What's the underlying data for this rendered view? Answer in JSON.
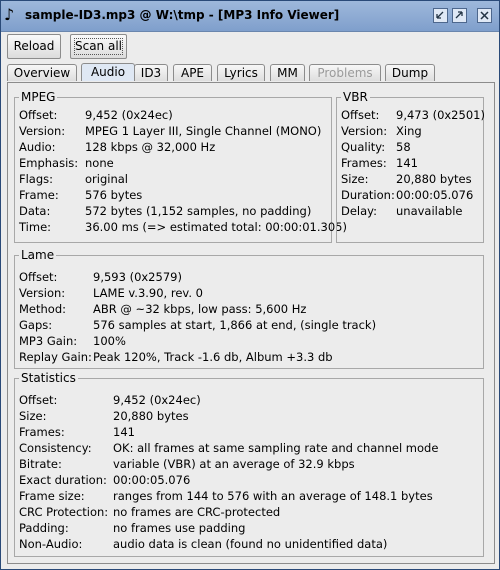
{
  "window": {
    "title": "sample-ID3.mp3 @ W:\\tmp - [MP3 Info Viewer]",
    "icon": "music-note-icon"
  },
  "toolbar": {
    "reload_label": "Reload",
    "scan_all_label": "Scan all"
  },
  "tabs": [
    {
      "label": "Overview"
    },
    {
      "label": "Audio"
    },
    {
      "label": "ID3"
    },
    {
      "label": "APE"
    },
    {
      "label": "Lyrics"
    },
    {
      "label": "MM"
    },
    {
      "label": "Problems"
    },
    {
      "label": "Dump"
    }
  ],
  "mpeg": {
    "title": "MPEG",
    "rows": [
      {
        "label": "Offset:",
        "value": "9,452 (0x24ec)"
      },
      {
        "label": "Version:",
        "value": "MPEG 1 Layer III, Single Channel (MONO)"
      },
      {
        "label": "Audio:",
        "value": "128 kbps @ 32,000 Hz"
      },
      {
        "label": "Emphasis:",
        "value": "none"
      },
      {
        "label": "Flags:",
        "value": "original"
      },
      {
        "label": "Frame:",
        "value": "576 bytes"
      },
      {
        "label": "Data:",
        "value": "572 bytes (1,152 samples, no padding)"
      },
      {
        "label": "Time:",
        "value": "36.00 ms (=> estimated total: 00:00:01.305)"
      }
    ]
  },
  "vbr": {
    "title": "VBR",
    "rows": [
      {
        "label": "Offset:",
        "value": "9,473 (0x2501)"
      },
      {
        "label": "Version:",
        "value": "Xing"
      },
      {
        "label": "Quality:",
        "value": "58"
      },
      {
        "label": "Frames:",
        "value": "141"
      },
      {
        "label": "Size:",
        "value": "20,880 bytes"
      },
      {
        "label": "Duration:",
        "value": "00:00:05.076"
      },
      {
        "label": "Delay:",
        "value": "unavailable"
      }
    ]
  },
  "lame": {
    "title": "Lame",
    "rows": [
      {
        "label": "Offset:",
        "value": "9,593 (0x2579)"
      },
      {
        "label": "Version:",
        "value": "LAME v.3.90, rev. 0"
      },
      {
        "label": "Method:",
        "value": "ABR @ ~32 kbps, low pass: 5,600 Hz"
      },
      {
        "label": "Gaps:",
        "value": "576 samples at start, 1,866 at end, (single track)"
      },
      {
        "label": "MP3 Gain:",
        "value": "100%"
      },
      {
        "label": "Replay Gain:",
        "value": "Peak 120%, Track -1.6 db, Album +3.3 db"
      }
    ]
  },
  "statistics": {
    "title": "Statistics",
    "rows": [
      {
        "label": "Offset:",
        "value": "9,452 (0x24ec)"
      },
      {
        "label": "Size:",
        "value": "20,880 bytes"
      },
      {
        "label": "Frames:",
        "value": "141"
      },
      {
        "label": "Consistency:",
        "value": "OK: all frames at same sampling rate and channel mode"
      },
      {
        "label": "Bitrate:",
        "value": "variable (VBR) at an average of 32.9 kbps"
      },
      {
        "label": "Exact duration:",
        "value": "00:00:05.076"
      },
      {
        "label": "Frame size:",
        "value": "ranges from 144 to 576 with an average of 148.1 bytes"
      },
      {
        "label": "CRC Protection:",
        "value": "no frames are CRC-protected"
      },
      {
        "label": "Padding:",
        "value": "no frames use padding"
      },
      {
        "label": "Non-Audio:",
        "value": "audio data is clean (found no unidentified data)"
      }
    ]
  }
}
